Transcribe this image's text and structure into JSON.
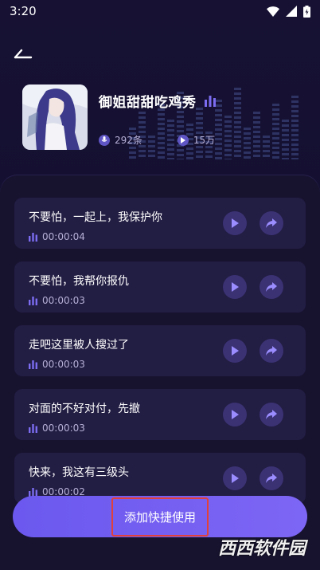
{
  "status": {
    "time": "3:20"
  },
  "profile": {
    "title": "御姐甜甜吃鸡秀",
    "count": "292条",
    "plays": "15万"
  },
  "items": [
    {
      "text": "不要怕，一起上，我保护你",
      "duration": "00:00:04"
    },
    {
      "text": "不要怕，我帮你报仇",
      "duration": "00:00:03"
    },
    {
      "text": "走吧这里被人搜过了",
      "duration": "00:00:03"
    },
    {
      "text": "对面的不好对付，先撤",
      "duration": "00:00:03"
    },
    {
      "text": "快来，我这有三级头",
      "duration": "00:00:02"
    }
  ],
  "action": {
    "label": "添加快捷使用"
  },
  "watermark": "西西软件园",
  "colors": {
    "accent": "#6b58ee",
    "card": "#221d43",
    "icon_button": "#3a3273",
    "highlight_border": "#e0413a"
  },
  "icons": [
    "back-arrow-icon",
    "wifi-icon",
    "signal-icon",
    "battery-icon",
    "equalizer-icon",
    "mic-icon",
    "play-icon",
    "share-icon"
  ]
}
